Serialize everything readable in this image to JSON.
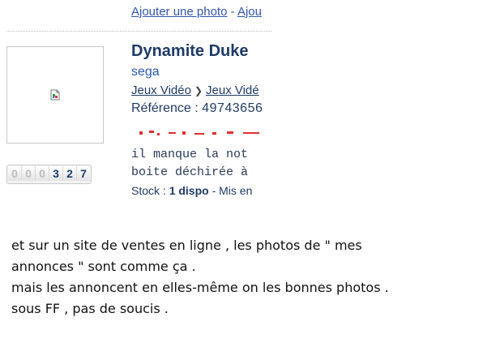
{
  "listing": {
    "top_links": {
      "add_photo": "Ajouter une photo",
      "separator": "-",
      "partial_link": "Ajou"
    },
    "title": "Dynamite Duke",
    "brand": "sega",
    "breadcrumb": [
      "Jeux Vidéo",
      "Jeux Vidé"
    ],
    "reference_label": "Référence :",
    "reference_value": "49743656",
    "description_lines": [
      "il manque la not",
      "boite déchirée à"
    ],
    "stock_label": "Stock :",
    "stock_value": "1 dispo",
    "stock_suffix": "- Mis en",
    "counter_digits": [
      "0",
      "0",
      "0",
      "3",
      "2",
      "7"
    ]
  },
  "comment": {
    "lines": [
      "et sur un site de ventes en ligne , les photos de \" mes",
      "annonces \" sont comme ça .",
      "mais les annoncent en elles-même on les bonnes photos .",
      "sous FF , pas de soucis ."
    ]
  }
}
